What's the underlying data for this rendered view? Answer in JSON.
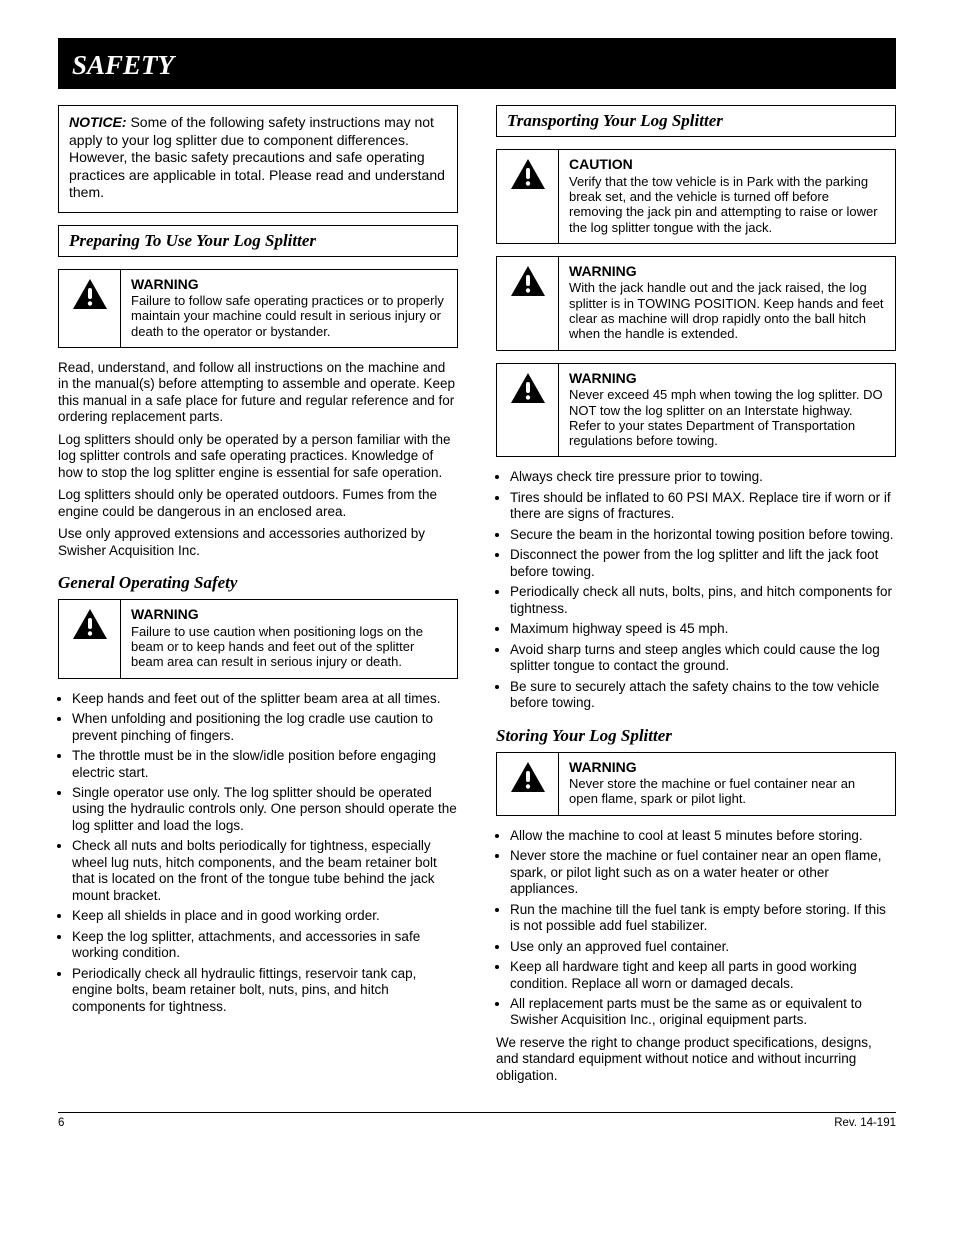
{
  "header": {
    "title": "SAFETY"
  },
  "left": {
    "note1": {
      "label": "NOTICE:",
      "text": " Some of the following safety instructions may not apply to your log splitter due to component differences. However, the basic safety precautions and safe operating practices are applicable in total. Please read and understand them."
    },
    "title1": "Preparing To Use Your Log Splitter",
    "w1": {
      "level": "WARNING",
      "text": "Failure to follow safe operating practices or to properly maintain your machine could result in serious injury or death to the operator or bystander."
    },
    "p1": "Read, understand, and follow all instructions on the machine and in the manual(s) before attempting to assemble and operate. Keep this manual in a safe place for future and regular reference and for ordering replacement parts.",
    "p2": "Log splitters should only be operated by a person familiar with the log splitter controls and safe operating practices. Knowledge of how to stop the log splitter engine is essential for safe operation.",
    "p3": "Log splitters should only be operated outdoors. Fumes from the engine could be dangerous in an enclosed area.",
    "p4": "Use only approved extensions and accessories authorized by Swisher Acquisition Inc.",
    "title2": "General Operating Safety",
    "w2": {
      "level": "WARNING",
      "text": "Failure to use caution when positioning logs on the beam or to keep hands and feet out of the splitter beam area can result in serious injury or death."
    },
    "bul1": [
      "Keep hands and feet out of the splitter beam area at all times.",
      "When unfolding and positioning the log cradle use caution to prevent pinching of fingers.",
      "The throttle must be in the slow/idle position before engaging electric start.",
      "Single operator use only. The log splitter should be operated using the hydraulic controls only. One person should operate the log splitter and load the logs.",
      "Check all nuts and bolts periodically for tightness, especially wheel lug nuts, hitch components, and the beam retainer bolt that is located on the front of the tongue tube behind the jack mount bracket.",
      "Keep all shields in place and in good working order.",
      "Keep the log splitter, attachments, and accessories in safe working condition.",
      "Periodically check all hydraulic fittings, reservoir tank cap, engine bolts, beam retainer bolt, nuts, pins, and hitch components for tightness."
    ]
  },
  "right": {
    "title1": "Transporting Your Log Splitter",
    "w1": {
      "level": "CAUTION",
      "text": "Verify that the tow vehicle is in Park with the parking break set, and the vehicle is turned off before removing the jack pin and attempting to raise or lower the log splitter tongue with the jack."
    },
    "w2": {
      "level": "WARNING",
      "text": "With the jack handle out and the jack raised, the log splitter is in TOWING POSITION. Keep hands and feet clear as machine will drop rapidly onto the ball hitch when the handle is extended."
    },
    "w3": {
      "level": "WARNING",
      "text": "Never exceed 45 mph when towing the log splitter. DO NOT tow the log splitter on an Interstate highway. Refer to your states Department of Transportation regulations before towing."
    },
    "bul1": [
      "Always check tire pressure prior to towing.",
      "Tires should be inflated to 60 PSI MAX. Replace tire if worn or if there are signs of fractures.",
      "Secure the beam in the horizontal towing position before towing.",
      "Disconnect the power from the log splitter and lift the jack foot before towing.",
      "Periodically check all nuts, bolts, pins, and hitch components for tightness.",
      "Maximum highway speed is 45 mph.",
      "Avoid sharp turns and steep angles which could cause the log splitter tongue to contact the ground.",
      "Be sure to securely attach the safety chains to the tow vehicle before towing."
    ],
    "title2": "Storing Your Log Splitter",
    "w4": {
      "level": "WARNING",
      "text": "Never store the machine or fuel container near an open flame, spark or pilot light."
    },
    "bul2": [
      "Allow the machine to cool at least 5 minutes before storing.",
      "Never store the machine or fuel container near an open flame, spark, or pilot light such as on a water heater or other appliances.",
      "Run the machine till the fuel tank is empty before storing. If this is not possible add fuel stabilizer.",
      "Use only an approved fuel container.",
      "Keep all hardware tight and keep all parts in good working condition. Replace all worn or damaged decals.",
      "All replacement parts must be the same as or equivalent to Swisher Acquisition Inc., original equipment parts."
    ],
    "p1": "We reserve the right to change product specifications, designs, and standard equipment without notice and without incurring obligation."
  },
  "footer": {
    "left": "6",
    "right": "Rev. 14-191"
  }
}
